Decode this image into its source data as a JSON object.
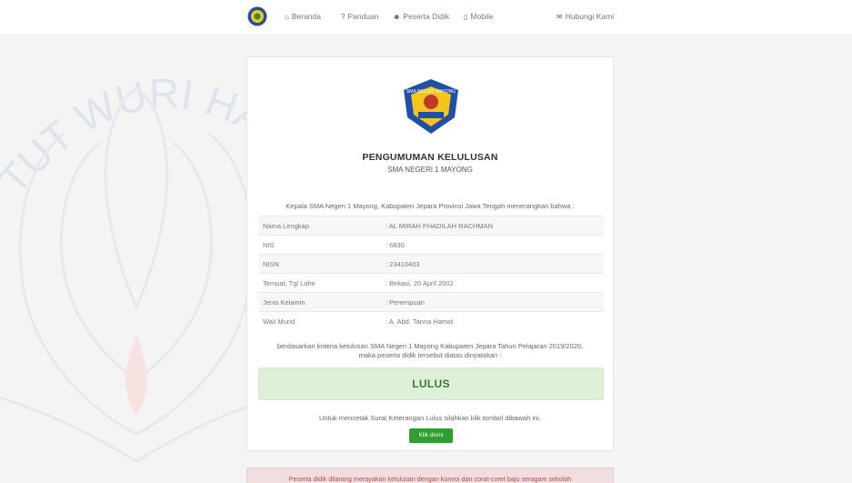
{
  "nav": {
    "items": [
      {
        "icon": "home-icon",
        "glyph": "⌂",
        "label": "Beranda"
      },
      {
        "icon": "question-icon",
        "glyph": "?",
        "label": "Panduan"
      },
      {
        "icon": "user-icon",
        "glyph": "☻",
        "label": "Peserta Didik"
      },
      {
        "icon": "mobile-icon",
        "glyph": "▯",
        "label": "Mobile"
      },
      {
        "icon": "envelope-icon",
        "glyph": "✉",
        "label": "Hubungi Kami"
      }
    ]
  },
  "watermark_text": "TUT WURI HANDAYANI",
  "crest_text": "SMA NEGERI MAYONG",
  "card": {
    "title": "PENGUMUMAN KELULUSAN",
    "subtitle": "SMA NEGERI 1 MAYONG",
    "intro": "Kepala SMA Negeri 1 Mayong, Kabupaten Jepara Provinsi Jawa Tengah menerangkan bahwa :",
    "rows": [
      {
        "label": "Nama Lengkap",
        "value": ": AL MIRAH FHADILAH RACHMAN"
      },
      {
        "label": "NIS",
        "value": ": 6830"
      },
      {
        "label": "NISN",
        "value": ": 23410403"
      },
      {
        "label": "Tempat, Tgl Lahir",
        "value": ": Bekasi, 20 April 2002"
      },
      {
        "label": "Jenis Kelamin",
        "value": ": Perempuan"
      },
      {
        "label": "Wali Murid",
        "value": ": A. Abd. Tanna Hamid"
      }
    ],
    "criteria_line1": "berdasarkan kriteria kelulusan SMA Negeri 1 Mayong Kabupaten Jepara Tahun Pelajaran 2019/2020,",
    "criteria_line2": "maka peserta didik tersebut diatas dinyatakan :",
    "result": "LULUS",
    "print_note": "Untuk mencetak Surat Keterangan Lulus silahkan klik tombol dibawah ini.",
    "button_label": "Klik disini"
  },
  "alert": "Peserta didik dilarang merayakan kelulusan dengan konvoi dan corat-coret baju seragam sekolah",
  "colors": {
    "result_bg": "#dff0d8",
    "result_text": "#3c763d",
    "button": "#2e9e2e",
    "alert_bg": "#f2dede",
    "alert_text": "#b94a48",
    "watermark": "#c8d8ec"
  }
}
